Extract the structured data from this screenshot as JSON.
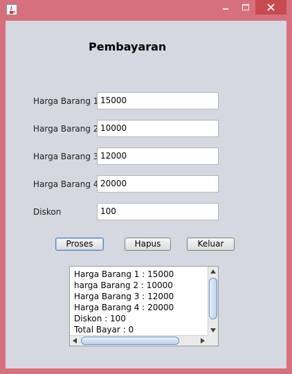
{
  "window": {
    "icon": "java-cup-icon"
  },
  "form": {
    "title": "Pembayaran",
    "fields": [
      {
        "label": "Harga Barang 1",
        "value": "15000"
      },
      {
        "label": "Harga Barang 2",
        "value": "10000"
      },
      {
        "label": "Harga Barang 3",
        "value": "12000"
      },
      {
        "label": "Harga Barang 4",
        "value": "20000"
      },
      {
        "label": "Diskon",
        "value": "100"
      }
    ],
    "buttons": {
      "proses": "Proses",
      "hapus": "Hapus",
      "keluar": "Keluar"
    }
  },
  "output": {
    "lines": [
      "Harga Barang 1 : 15000",
      "harga Barang 2 : 10000",
      "Harga Barang 3 : 12000",
      "Harga Barang 4 : 20000",
      "Diskon : 100",
      "Total Bayar : 0"
    ]
  },
  "colors": {
    "frame": "#d6707f",
    "client": "#d5d8e0",
    "close_button": "#c74b51"
  }
}
